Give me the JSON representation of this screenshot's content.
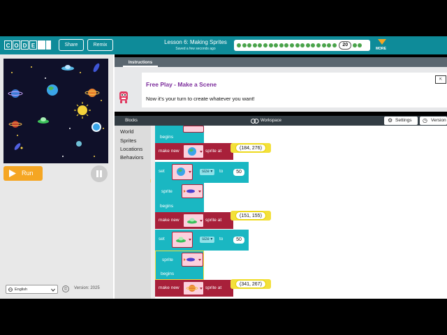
{
  "header": {
    "logo_letters": [
      "C",
      "O",
      "D",
      "E"
    ],
    "share_label": "Share",
    "remix_label": "Remix",
    "lesson_title": "Lesson 6: Making Sprites",
    "saved_status": "Saved a few seconds ago",
    "current_level": "20",
    "more_label": "MORE"
  },
  "stage": {
    "run_label": "Run"
  },
  "footer": {
    "language": "English",
    "version": "Version: 2025"
  },
  "instructions": {
    "tab_label": "Instructions",
    "title": "Free Play - Make a Scene",
    "text": "Now it's your turn to create whatever you want!"
  },
  "workspace": {
    "blocks_tab": "Blocks",
    "workspace_label": "Workspace",
    "settings_label": "Settings",
    "version_label": "Version"
  },
  "toolbox": {
    "categories": [
      "World",
      "Sprites",
      "Locations",
      "Behaviors"
    ]
  },
  "code": {
    "begins": "begins",
    "make_new": "make new",
    "sprite_at": "sprite at",
    "set": "set",
    "size": "size",
    "to": "to",
    "sprite": "sprite",
    "coords": [
      "(184, 276)",
      "(151, 155)",
      "(341, 267)"
    ],
    "size_values": [
      "50",
      "50"
    ]
  },
  "colors": {
    "header_teal": "#0e8b99",
    "run_orange": "#f5a623",
    "block_teal": "#1ab7c2",
    "block_maroon": "#a8203a",
    "title_purple": "#7c2d9c"
  }
}
